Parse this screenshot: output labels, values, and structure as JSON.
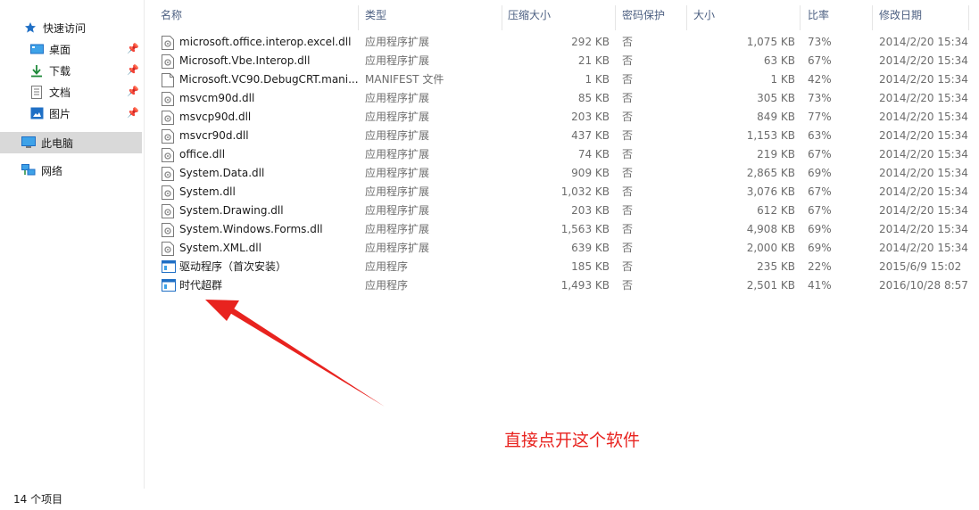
{
  "sidebar": {
    "quick_access": "快速访问",
    "items": [
      {
        "label": "桌面",
        "icon": "desktop-icon"
      },
      {
        "label": "下载",
        "icon": "download-icon"
      },
      {
        "label": "文档",
        "icon": "document-icon"
      },
      {
        "label": "图片",
        "icon": "picture-icon"
      }
    ],
    "this_pc": "此电脑",
    "network": "网络"
  },
  "columns": {
    "name": "名称",
    "type": "类型",
    "compressed_size": "压缩大小",
    "password": "密码保护",
    "size": "大小",
    "ratio": "比率",
    "modified": "修改日期"
  },
  "files": [
    {
      "name": "microsoft.office.interop.excel.dll",
      "type": "应用程序扩展",
      "csize": "292 KB",
      "pwd": "否",
      "size": "1,075 KB",
      "ratio": "73%",
      "date": "2014/2/20 15:34",
      "icon": "dll-file-icon"
    },
    {
      "name": "Microsoft.Vbe.Interop.dll",
      "type": "应用程序扩展",
      "csize": "21 KB",
      "pwd": "否",
      "size": "63 KB",
      "ratio": "67%",
      "date": "2014/2/20 15:34",
      "icon": "dll-file-icon"
    },
    {
      "name": "Microsoft.VC90.DebugCRT.mani...",
      "type": "MANIFEST 文件",
      "csize": "1 KB",
      "pwd": "否",
      "size": "1 KB",
      "ratio": "42%",
      "date": "2014/2/20 15:34",
      "icon": "blank-file-icon"
    },
    {
      "name": "msvcm90d.dll",
      "type": "应用程序扩展",
      "csize": "85 KB",
      "pwd": "否",
      "size": "305 KB",
      "ratio": "73%",
      "date": "2014/2/20 15:34",
      "icon": "dll-file-icon"
    },
    {
      "name": "msvcp90d.dll",
      "type": "应用程序扩展",
      "csize": "203 KB",
      "pwd": "否",
      "size": "849 KB",
      "ratio": "77%",
      "date": "2014/2/20 15:34",
      "icon": "dll-file-icon"
    },
    {
      "name": "msvcr90d.dll",
      "type": "应用程序扩展",
      "csize": "437 KB",
      "pwd": "否",
      "size": "1,153 KB",
      "ratio": "63%",
      "date": "2014/2/20 15:34",
      "icon": "dll-file-icon"
    },
    {
      "name": "office.dll",
      "type": "应用程序扩展",
      "csize": "74 KB",
      "pwd": "否",
      "size": "219 KB",
      "ratio": "67%",
      "date": "2014/2/20 15:34",
      "icon": "dll-file-icon"
    },
    {
      "name": "System.Data.dll",
      "type": "应用程序扩展",
      "csize": "909 KB",
      "pwd": "否",
      "size": "2,865 KB",
      "ratio": "69%",
      "date": "2014/2/20 15:34",
      "icon": "dll-file-icon"
    },
    {
      "name": "System.dll",
      "type": "应用程序扩展",
      "csize": "1,032 KB",
      "pwd": "否",
      "size": "3,076 KB",
      "ratio": "67%",
      "date": "2014/2/20 15:34",
      "icon": "dll-file-icon"
    },
    {
      "name": "System.Drawing.dll",
      "type": "应用程序扩展",
      "csize": "203 KB",
      "pwd": "否",
      "size": "612 KB",
      "ratio": "67%",
      "date": "2014/2/20 15:34",
      "icon": "dll-file-icon"
    },
    {
      "name": "System.Windows.Forms.dll",
      "type": "应用程序扩展",
      "csize": "1,563 KB",
      "pwd": "否",
      "size": "4,908 KB",
      "ratio": "69%",
      "date": "2014/2/20 15:34",
      "icon": "dll-file-icon"
    },
    {
      "name": "System.XML.dll",
      "type": "应用程序扩展",
      "csize": "639 KB",
      "pwd": "否",
      "size": "2,000 KB",
      "ratio": "69%",
      "date": "2014/2/20 15:34",
      "icon": "dll-file-icon"
    },
    {
      "name": "驱动程序（首次安装）",
      "type": "应用程序",
      "csize": "185 KB",
      "pwd": "否",
      "size": "235 KB",
      "ratio": "22%",
      "date": "2015/6/9 15:02",
      "icon": "application-icon"
    },
    {
      "name": "时代超群",
      "type": "应用程序",
      "csize": "1,493 KB",
      "pwd": "否",
      "size": "2,501 KB",
      "ratio": "41%",
      "date": "2016/10/28 8:57",
      "icon": "application-icon"
    }
  ],
  "status": {
    "item_count": "14 个项目"
  },
  "annotation": {
    "text": "直接点开这个软件",
    "color": "#e8231f"
  },
  "colors": {
    "header_text": "#4d6082",
    "selected_nav": "#d9d9d9",
    "accent": "#1f6fc5"
  }
}
